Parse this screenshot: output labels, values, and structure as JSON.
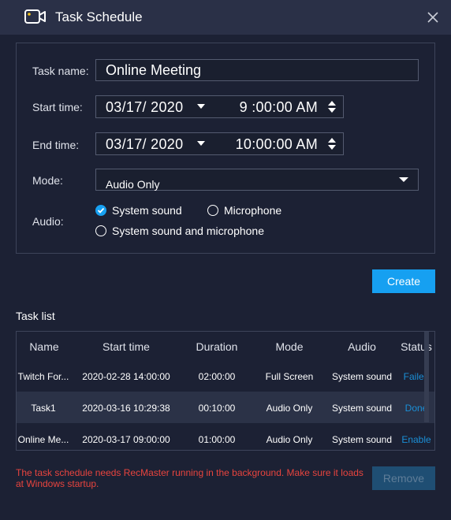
{
  "window": {
    "title": "Task Schedule",
    "icon": "video-camera-icon",
    "close_icon": "close-icon"
  },
  "form": {
    "task_name_label": "Task name:",
    "task_name_value": "Online Meeting",
    "start_time_label": "Start time:",
    "start_date": "03/17/ 2020",
    "start_time": "9 :00:00  AM",
    "end_time_label": "End time:",
    "end_date": "03/17/ 2020",
    "end_time": "10:00:00  AM",
    "mode_label": "Mode:",
    "mode_value": "Audio Only",
    "audio_label": "Audio:",
    "audio_options": [
      {
        "label": "System sound",
        "checked": true
      },
      {
        "label": "Microphone",
        "checked": false
      },
      {
        "label": "System sound and microphone",
        "checked": false
      }
    ]
  },
  "actions": {
    "create_label": "Create",
    "remove_label": "Remove"
  },
  "task_list": {
    "title": "Task list",
    "columns": [
      "Name",
      "Start time",
      "Duration",
      "Mode",
      "Audio",
      "Status"
    ],
    "rows": [
      {
        "name": "Twitch For...",
        "start": "2020-02-28 14:00:00",
        "duration": "02:00:00",
        "mode": "Full Screen",
        "audio": "System sound",
        "status": "Failed",
        "selected": false
      },
      {
        "name": "Task1",
        "start": "2020-03-16 10:29:38",
        "duration": "00:10:00",
        "mode": "Audio Only",
        "audio": "System sound",
        "status": "Done",
        "selected": true
      },
      {
        "name": "Online Me...",
        "start": "2020-03-17 09:00:00",
        "duration": "01:00:00",
        "mode": "Audio Only",
        "audio": "System sound",
        "status": "Enable",
        "selected": false
      }
    ]
  },
  "footer_note": "The task schedule needs RecMaster running in the background. Make sure it loads at Windows startup.",
  "colors": {
    "accent": "#16a0f1",
    "background": "#1c2134",
    "titlebar": "#2a3047",
    "warning": "#e8443e",
    "status_link": "#1b8fd6"
  }
}
